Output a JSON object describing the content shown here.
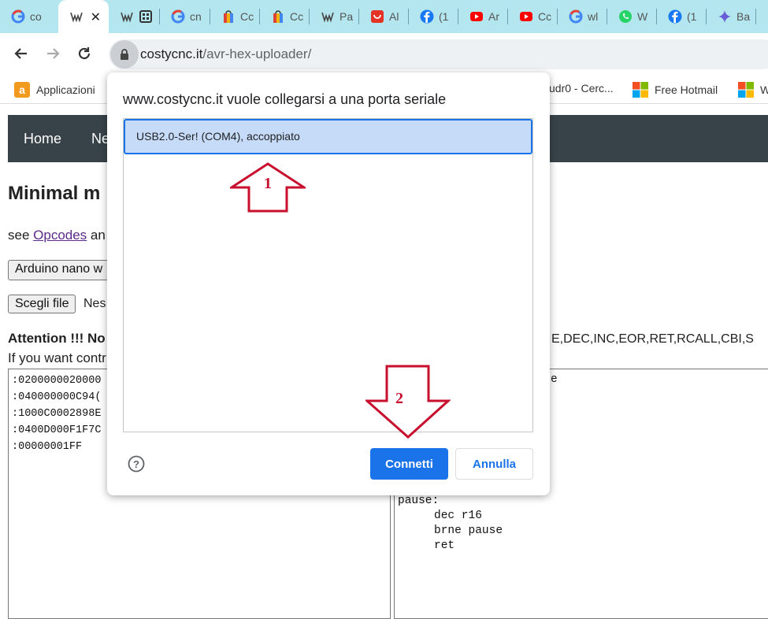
{
  "browser": {
    "tabs": [
      {
        "label": "co",
        "icon": "google-icon"
      },
      {
        "label": "",
        "icon": "costycnc-icon",
        "active": true
      },
      {
        "label": "",
        "icon": "costycnc-icon"
      },
      {
        "label": "cn",
        "icon": "google-icon"
      },
      {
        "label": "Cc",
        "icon": "shopping-bag-icon"
      },
      {
        "label": "Cc",
        "icon": "shopping-bag-icon"
      },
      {
        "label": "Pa",
        "icon": "costycnc-icon"
      },
      {
        "label": "Al",
        "icon": "aliexpress-icon"
      },
      {
        "label": "(1",
        "icon": "facebook-icon"
      },
      {
        "label": "Ar",
        "icon": "youtube-icon"
      },
      {
        "label": "Cc",
        "icon": "youtube-icon"
      },
      {
        "label": "wl",
        "icon": "google-icon"
      },
      {
        "label": "W",
        "icon": "whatsapp-icon"
      },
      {
        "label": "(1",
        "icon": "facebook-icon"
      },
      {
        "label": "Ba",
        "icon": "gemini-icon"
      }
    ],
    "url_domain": "costycnc.it",
    "url_path": "/avr-hex-uploader/",
    "bookmarks": [
      {
        "label": "Applicazioni",
        "icon": "amazon-icon"
      },
      {
        "label": "udr0 - Cerc...",
        "icon": ""
      },
      {
        "label": "Free Hotmail",
        "icon": "microsoft-icon"
      },
      {
        "label": "W",
        "icon": "microsoft-icon"
      }
    ]
  },
  "page": {
    "nav": {
      "home": "Home",
      "next": "Ne"
    },
    "heading": "Minimal m",
    "see_prefix": "see ",
    "see_link": "Opcodes",
    "see_suffix": " an",
    "board_select": "Arduino nano w",
    "file_button": "Scegli file",
    "file_status": "Nes",
    "attention": "Attention !!! No",
    "attention_right": "E,DEC,INC,EOR,RET,RCALL,CBI,S",
    "if_line": "If you want contr",
    "hex_lines": [
      ":0200000020000",
      ":040000000C94(",
      ":1000C0002898E",
      ":0400D000F1F7C",
      ":00000001FF"
    ],
    "asm_top": "e",
    "asm_label": "pause:",
    "asm_lines": [
      "dec r16",
      "brne pause",
      "ret"
    ]
  },
  "dialog": {
    "title": "www.costycnc.it vuole collegarsi a una porta seriale",
    "device": "USB2.0-Ser! (COM4), accoppiato",
    "connect": "Connetti",
    "cancel": "Annulla"
  },
  "annotations": {
    "arrow1": "1",
    "arrow2": "2",
    "color": "#c8102e"
  },
  "colors": {
    "tabbar": "#b3e6ee",
    "navbar": "#384349",
    "accent": "#1a73e8",
    "selected": "#c5dbf7"
  }
}
